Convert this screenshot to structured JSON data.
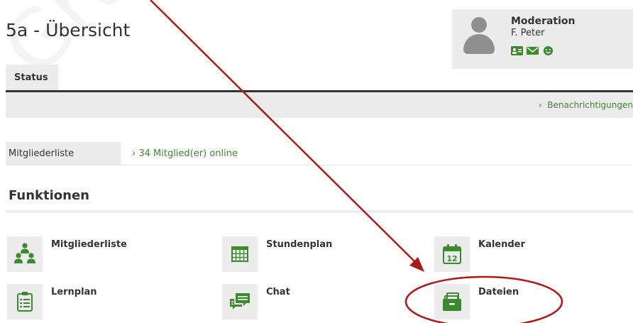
{
  "watermark": "Gru",
  "page": {
    "title": "5a - Übersicht"
  },
  "profile": {
    "role": "Moderation",
    "name": "F. Peter",
    "icons": [
      "contact-card-icon",
      "mail-icon",
      "smiley-icon"
    ]
  },
  "tabs": [
    {
      "label": "Status",
      "active": true
    }
  ],
  "notifications": {
    "link_label": "Benachrichtigungen"
  },
  "members": {
    "label": "Mitgliederliste",
    "online_label": "34 Mitglied(er) online"
  },
  "functions": {
    "title": "Funktionen",
    "items": [
      {
        "label": "Mitgliederliste",
        "icon": "members-icon"
      },
      {
        "label": "Stundenplan",
        "icon": "timetable-icon"
      },
      {
        "label": "Kalender",
        "icon": "calendar-icon",
        "icon_text": "12"
      },
      {
        "label": "Lernplan",
        "icon": "learning-plan-icon"
      },
      {
        "label": "Chat",
        "icon": "chat-icon"
      },
      {
        "label": "Dateien",
        "icon": "files-icon"
      }
    ]
  },
  "colors": {
    "accent_green": "#3c8a2e",
    "annotation_red": "#b01a16",
    "panel_grey": "#ececec"
  }
}
